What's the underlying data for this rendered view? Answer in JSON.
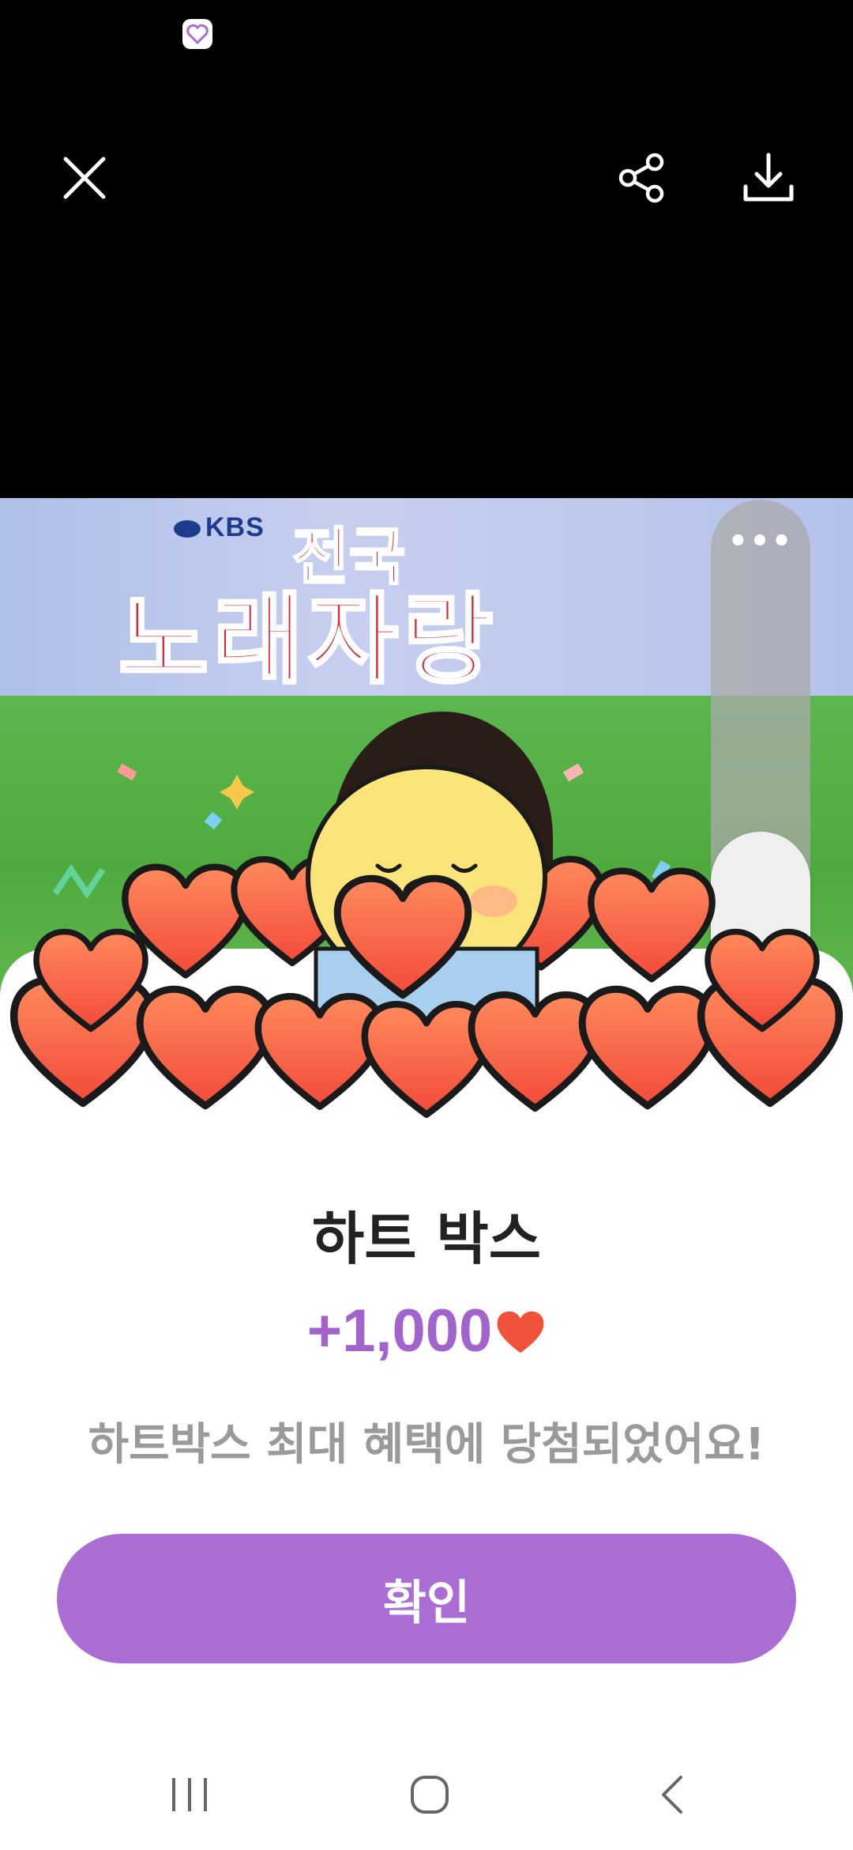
{
  "status_bar": {
    "app_icon": "heart-app-icon"
  },
  "toolbar": {
    "close_icon": "close-icon",
    "share_icon": "share-icon",
    "download_icon": "download-icon"
  },
  "video": {
    "channel_logo": "KBS",
    "program_title_line1": "전국",
    "program_title_line2": "노래자랑"
  },
  "side_panel": {
    "more_label": "•••",
    "sound_icon": "music-note-sound-icon"
  },
  "sheet": {
    "title": "하트 박스",
    "reward_amount": "+1,000",
    "reward_icon": "heart-icon",
    "description": "하트박스 최대 혜택에 당첨되었어요!",
    "confirm_label": "확인"
  },
  "colors": {
    "accent": "#a96dd4",
    "reward_text": "#a363cc",
    "heart": "#f0523a"
  },
  "nav": {
    "recent_icon": "recent-apps-icon",
    "home_icon": "home-icon",
    "back_icon": "back-icon"
  }
}
